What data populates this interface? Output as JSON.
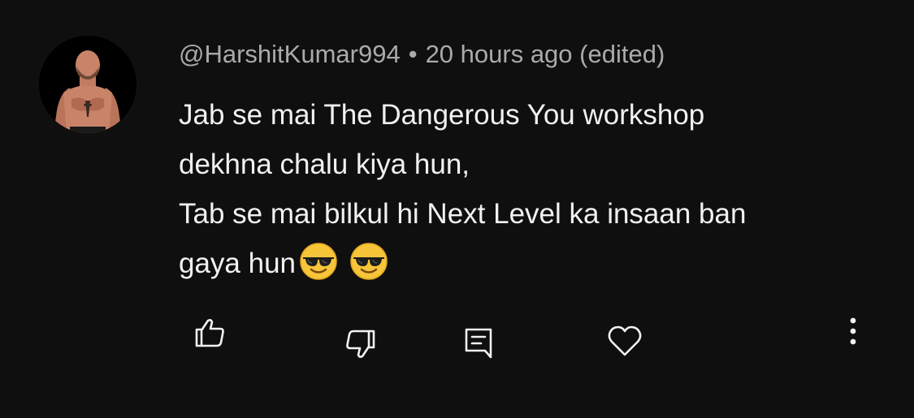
{
  "comment": {
    "author": "@HarshitKumar994",
    "separator": "•",
    "timestamp": "20 hours ago",
    "edited_label": "(edited)",
    "text_lines": [
      "Jab se mai The Dangerous You workshop",
      "dekhna chalu kiya hun,",
      "Tab se mai bilkul hi Next Level ka insaan ban",
      "gaya hun"
    ],
    "emojis": [
      "smiling-face-with-sunglasses",
      "smiling-face-with-sunglasses"
    ]
  },
  "actions": {
    "like_icon": "thumbs-up-icon",
    "dislike_icon": "thumbs-down-icon",
    "reply_icon": "reply-comment-icon",
    "heart_icon": "heart-icon",
    "more_icon": "more-vertical-icon"
  },
  "colors": {
    "background": "#0f0f0f",
    "text_primary": "#f1f1f1",
    "text_secondary": "#aaaaaa"
  }
}
